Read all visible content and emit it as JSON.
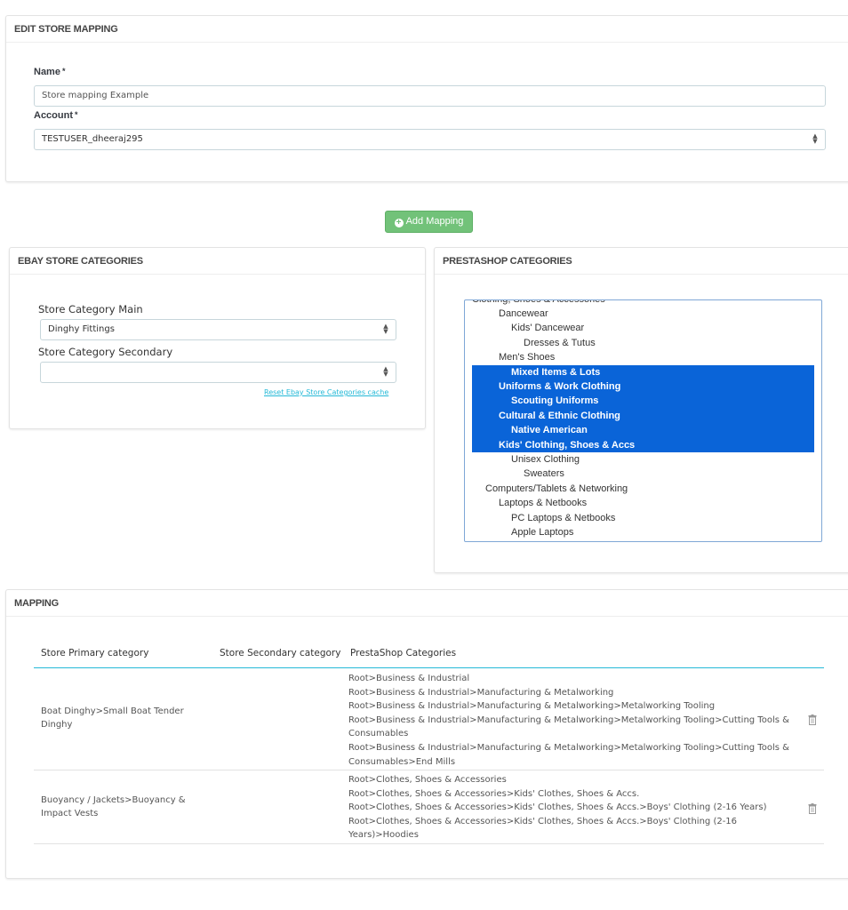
{
  "edit_panel": {
    "title": "EDIT STORE MAPPING",
    "name_label": "Name",
    "name_value": "Store mapping Example",
    "account_label": "Account",
    "account_value": "TESTUSER_dheeraj295",
    "required_mark": "*"
  },
  "add_mapping_button": "Add Mapping",
  "ebay_panel": {
    "title": "EBAY STORE CATEGORIES",
    "main_label": "Store Category Main",
    "main_value": "Dinghy Fittings",
    "secondary_label": "Store Category Secondary",
    "secondary_value": "",
    "reset_link": "Reset Ebay Store Categories cache"
  },
  "prestashop_panel": {
    "title": "PRESTASHOP CATEGORIES",
    "tree_items": [
      {
        "label": "Clothing, Shoes & Accessories",
        "selected": false
      },
      {
        "label": "Dancewear",
        "selected": false
      },
      {
        "label": "Kids' Dancewear",
        "selected": false
      },
      {
        "label": "Dresses & Tutus",
        "selected": false
      },
      {
        "label": "Men's Shoes",
        "selected": false
      },
      {
        "label": "Mixed Items & Lots",
        "selected": true
      },
      {
        "label": "Uniforms & Work Clothing",
        "selected": true
      },
      {
        "label": "Scouting Uniforms",
        "selected": true
      },
      {
        "label": "Cultural & Ethnic Clothing",
        "selected": true
      },
      {
        "label": "Native American",
        "selected": true
      },
      {
        "label": "Kids' Clothing, Shoes & Accs",
        "selected": true
      },
      {
        "label": "Unisex Clothing",
        "selected": false
      },
      {
        "label": "Sweaters",
        "selected": false
      },
      {
        "label": "Computers/Tablets & Networking",
        "selected": false
      },
      {
        "label": "Laptops & Netbooks",
        "selected": false
      },
      {
        "label": "PC Laptops & Netbooks",
        "selected": false
      },
      {
        "label": "Apple Laptops",
        "selected": false
      }
    ],
    "selection_color": "#0a64d8"
  },
  "mapping_panel": {
    "title": "MAPPING",
    "columns": [
      "Store Primary category",
      "Store Secondary category",
      "PrestaShop Categories"
    ],
    "rows": [
      {
        "primary": "Boat Dinghy>Small Boat Tender Dinghy",
        "secondary": "",
        "categories": [
          "Root>Business & Industrial",
          "Root>Business & Industrial>Manufacturing & Metalworking",
          "Root>Business & Industrial>Manufacturing & Metalworking>Metalworking Tooling",
          "Root>Business & Industrial>Manufacturing & Metalworking>Metalworking Tooling>Cutting Tools & Consumables",
          "Root>Business & Industrial>Manufacturing & Metalworking>Metalworking Tooling>Cutting Tools & Consumables>End Mills"
        ]
      },
      {
        "primary": "Buoyancy / Jackets>Buoyancy & Impact Vests",
        "secondary": "",
        "categories": [
          "Root>Clothes, Shoes & Accessories",
          "Root>Clothes, Shoes & Accessories>Kids' Clothes, Shoes & Accs.",
          "Root>Clothes, Shoes & Accessories>Kids' Clothes, Shoes & Accs.>Boys' Clothing (2-16 Years)",
          "Root>Clothes, Shoes & Accessories>Kids' Clothes, Shoes & Accs.>Boys' Clothing (2-16 Years)>Hoodies"
        ]
      }
    ]
  },
  "colors": {
    "button_green": "#72c279",
    "link_blue": "#25b9d7",
    "table_header_line": "#25b9d7"
  }
}
